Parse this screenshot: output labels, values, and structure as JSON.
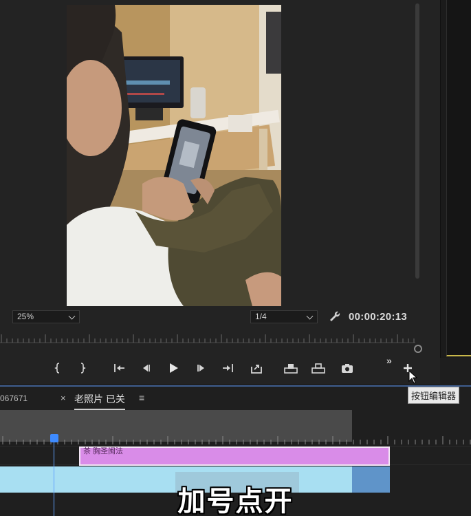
{
  "monitor": {
    "zoom_level": "25%",
    "resolution": "1/4",
    "timecode": "00:00:20:13"
  },
  "transport": {
    "buttons": [
      "mark-in-icon",
      "mark-out-icon",
      "go-to-in-icon",
      "step-back-icon",
      "play-icon",
      "step-forward-icon",
      "go-to-out-icon",
      "insert-icon",
      "lift-icon",
      "extract-icon",
      "export-frame-icon"
    ],
    "more": "»",
    "add_label": "+"
  },
  "tooltip": {
    "text": "按钮编辑器"
  },
  "timeline": {
    "sequence_number": "067671",
    "close_symbol": "×",
    "sequence_tab": "老照片 已关",
    "menu_symbol": "≡",
    "clip_label": "茶  胸圣闽法"
  },
  "subtitle": {
    "text": "加号点开"
  },
  "colors": {
    "accent": "#3e8bff",
    "title_clip": "#d98ce8",
    "video_clip": "#a8dff2",
    "tooltip_bg": "#e9e9e9"
  }
}
